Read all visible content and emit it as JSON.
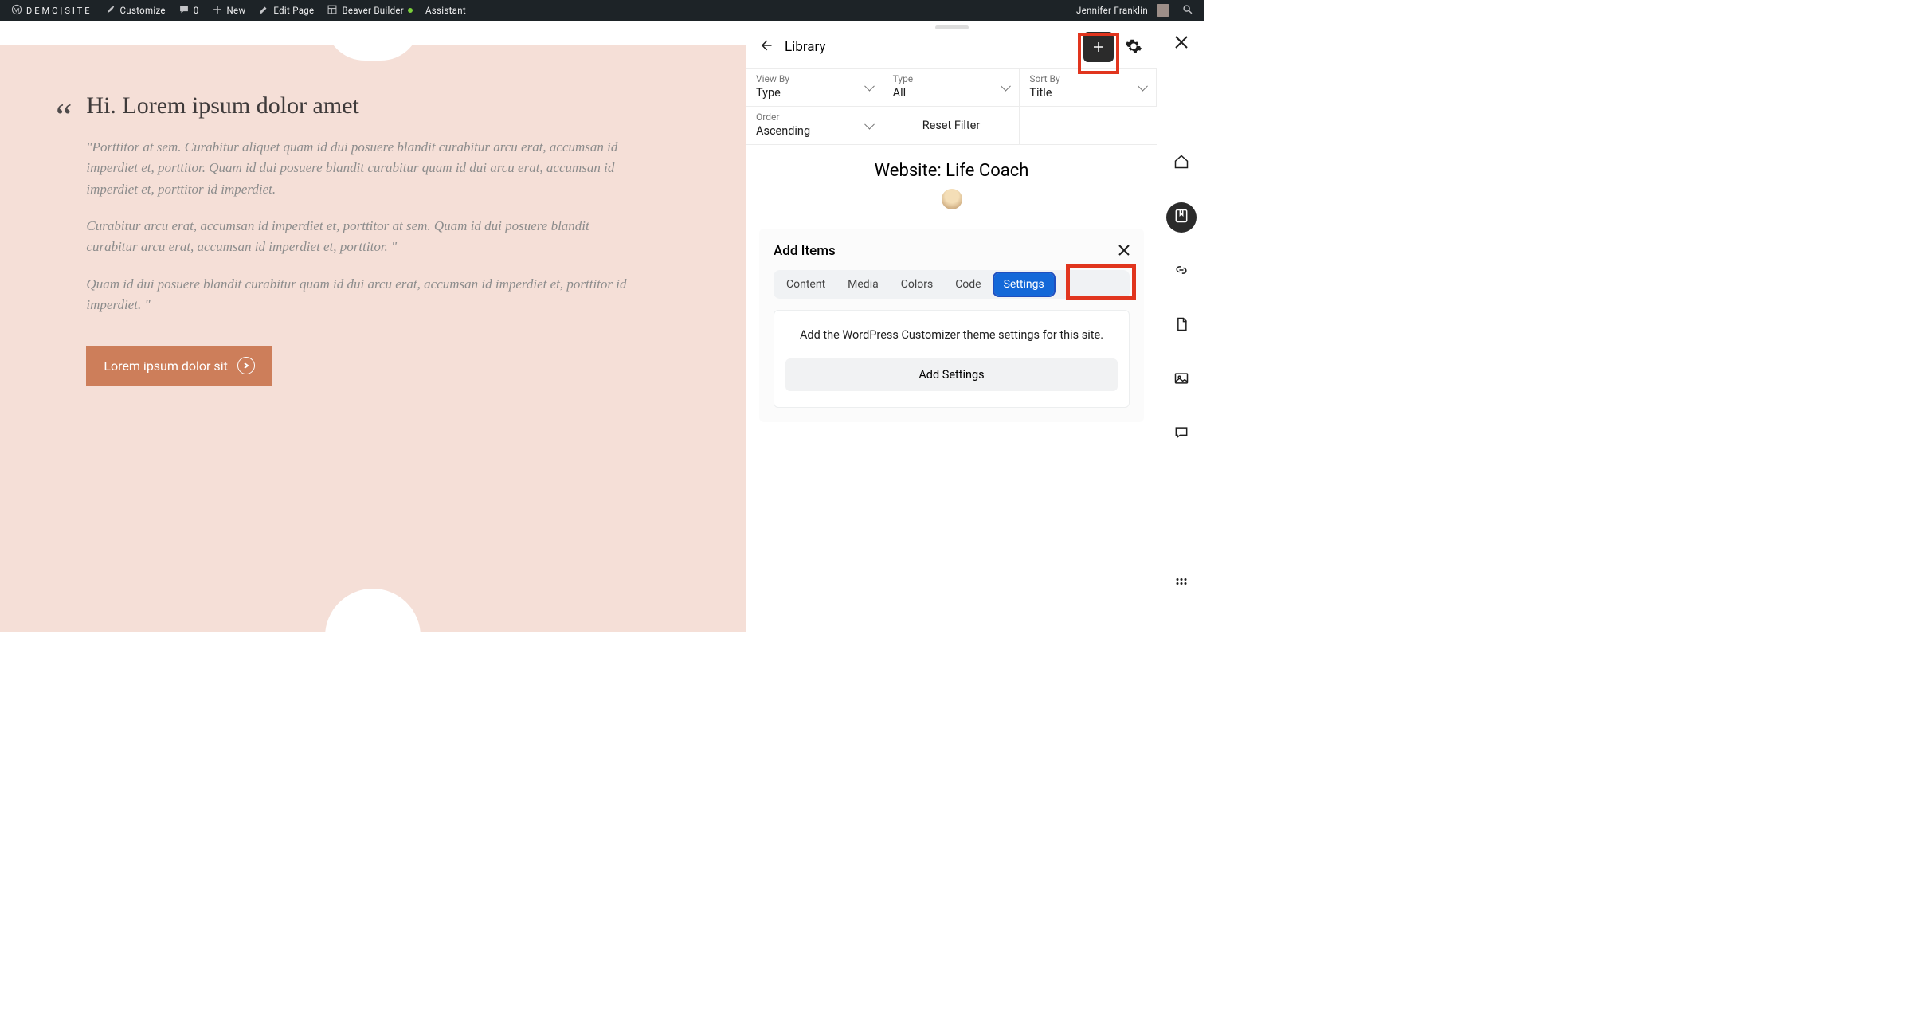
{
  "adminbar": {
    "site_name": "DEMO|SITE",
    "customize": "Customize",
    "comments_count": "0",
    "new": "New",
    "edit_page": "Edit Page",
    "beaver_builder": "Beaver Builder",
    "assistant": "Assistant",
    "user_name": "Jennifer Franklin"
  },
  "hero": {
    "heading": "Hi. Lorem ipsum dolor amet",
    "p1": "\"Porttitor at sem. Curabitur aliquet quam id dui posuere blandit curabitur arcu erat, accumsan id imperdiet et, porttitor. Quam id dui posuere blandit curabitur quam id dui arcu erat, accumsan id imperdiet et, porttitor id imperdiet.",
    "p2": "Curabitur arcu erat, accumsan id imperdiet et, porttitor at sem. Quam id dui posuere blandit curabitur arcu erat, accumsan id imperdiet et, porttitor. \"",
    "p3": "Quam id dui posuere blandit curabitur quam id dui arcu erat, accumsan id imperdiet et, porttitor id imperdiet. \"",
    "cta": "Lorem ipsum dolor sit"
  },
  "panel": {
    "title": "Library",
    "filters": {
      "view_by_label": "View By",
      "view_by_value": "Type",
      "type_label": "Type",
      "type_value": "All",
      "sort_by_label": "Sort By",
      "sort_by_value": "Title",
      "order_label": "Order",
      "order_value": "Ascending",
      "reset": "Reset Filter"
    },
    "site_title": "Website: Life Coach",
    "add_items": {
      "title": "Add Items",
      "tabs": {
        "content": "Content",
        "media": "Media",
        "colors": "Colors",
        "code": "Code",
        "settings": "Settings"
      },
      "settings_help": "Add the WordPress Customizer theme settings for this site.",
      "add_button": "Add Settings"
    }
  }
}
